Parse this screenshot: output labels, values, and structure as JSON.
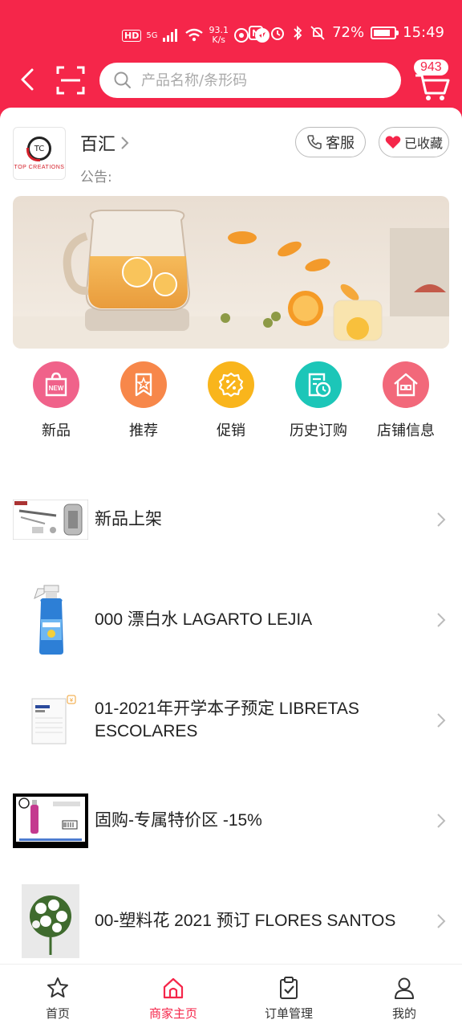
{
  "status_bar": {
    "hd": "HD",
    "network": "5G",
    "speed_value": "93.1",
    "speed_unit": "K/s",
    "battery": "72%",
    "time": "15:49"
  },
  "header": {
    "search_placeholder": "产品名称/条形码",
    "cart_count": "943",
    "brand_color": "#f5264a"
  },
  "store": {
    "name": "百汇",
    "logo_text": "TOP CREATIONS",
    "logo_mark": "TC",
    "notice_label": "公告:",
    "service_label": "客服",
    "favorite_label": "已收藏"
  },
  "categories": [
    {
      "label": "新品",
      "icon": "new-icon",
      "color": "#f0628a"
    },
    {
      "label": "推荐",
      "icon": "recommend-icon",
      "color": "#f7874a"
    },
    {
      "label": "促销",
      "icon": "promotion-icon",
      "color": "#f9b51c"
    },
    {
      "label": "历史订购",
      "icon": "history-icon",
      "color": "#1cc6b8"
    },
    {
      "label": "店铺信息",
      "icon": "store-info-icon",
      "color": "#f2687a"
    }
  ],
  "product_groups": [
    {
      "title": "新品上架"
    },
    {
      "title": "000  漂白水  LAGARTO LEJIA"
    },
    {
      "title": "01-2021年开学本子预定 LIBRETAS ESCOLARES"
    },
    {
      "title": "固购-专属特价区 -15%"
    },
    {
      "title": "00-塑料花 2021 预订 FLORES SANTOS"
    }
  ],
  "tabs": [
    {
      "label": "首页",
      "icon": "star-icon",
      "active": false
    },
    {
      "label": "商家主页",
      "icon": "home-icon",
      "active": true
    },
    {
      "label": "订单管理",
      "icon": "clipboard-check-icon",
      "active": false
    },
    {
      "label": "我的",
      "icon": "user-icon",
      "active": false
    }
  ]
}
